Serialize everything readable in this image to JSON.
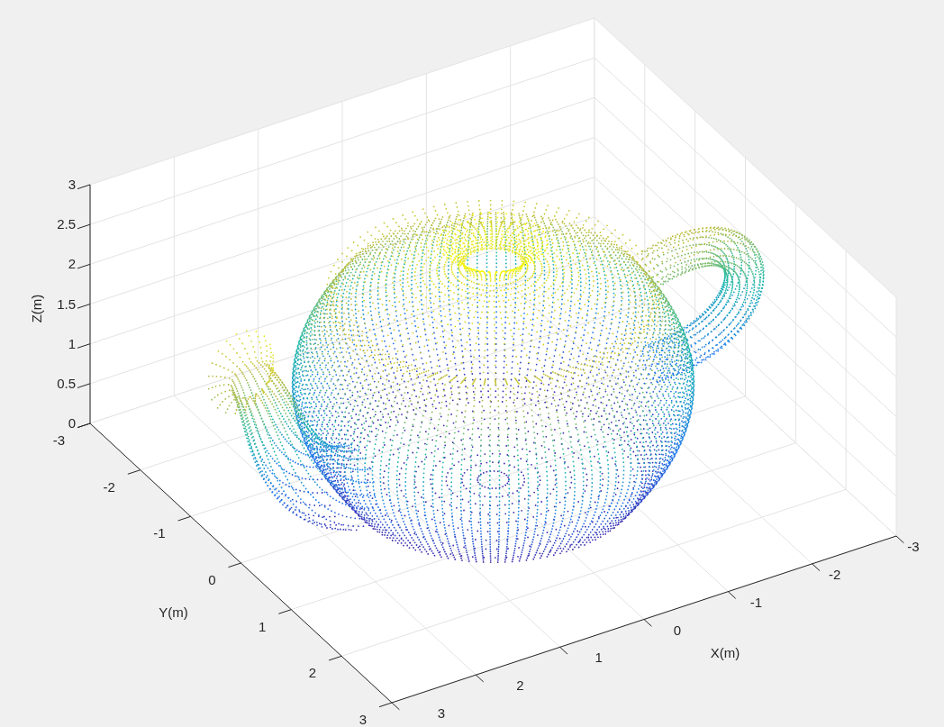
{
  "figure": {
    "axes": {
      "xlabel": "X(m)",
      "ylabel": "Y(m)",
      "zlabel": "Z(m)",
      "xticks": [
        "3",
        "2",
        "1",
        "0",
        "-1",
        "-2",
        "-3"
      ],
      "yticks": [
        "-3",
        "-2",
        "-1",
        "0",
        "1",
        "2",
        "3"
      ],
      "zticks": [
        "3",
        "2.5",
        "2",
        "1.5",
        "1",
        "0.5",
        "0"
      ]
    }
  }
}
